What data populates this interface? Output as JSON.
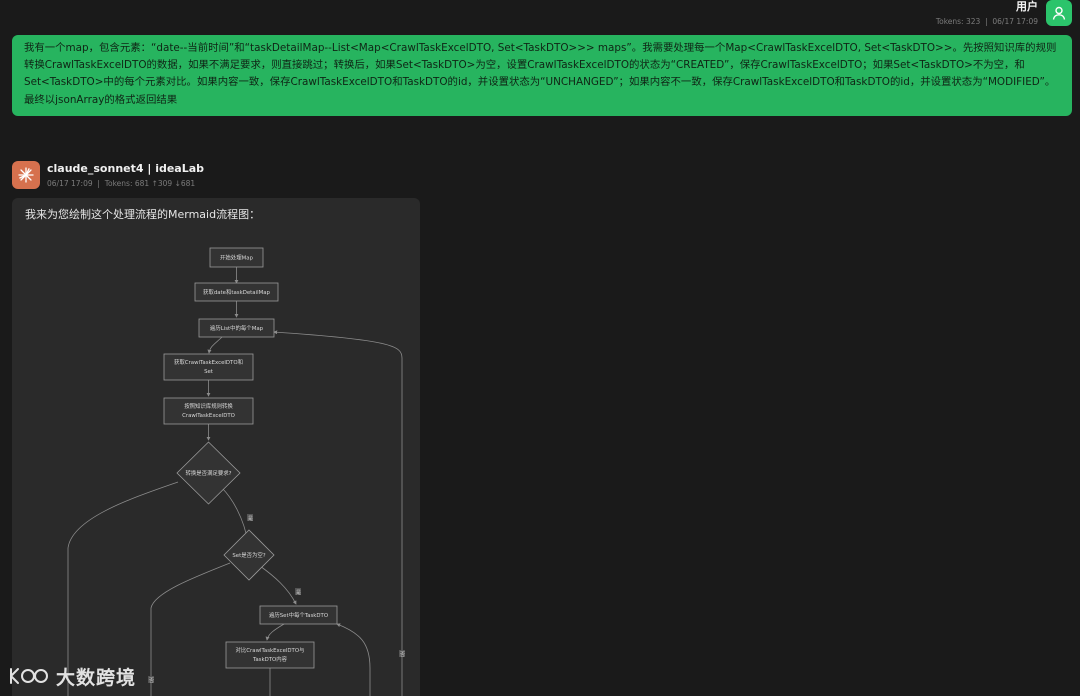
{
  "user": {
    "name": "用户",
    "tokens": "Tokens: 323",
    "time": "06/17 17:09",
    "message": "我有一个map，包含元素：“date--当前时间”和“taskDetailMap--List<Map<CrawlTaskExcelDTO, Set<TaskDTO>>> maps”。我需要处理每一个Map<CrawlTaskExcelDTO, Set<TaskDTO>>。先按照知识库的规则转换CrawlTaskExcelDTO的数据，如果不满足要求，则直接跳过；转换后，如果Set<TaskDTO>为空，设置CrawlTaskExcelDTO的状态为“CREATED”，保存CrawlTaskExcelDTO；如果Set<TaskDTO>不为空，和Set<TaskDTO>中的每个元素对比。如果内容一致，保存CrawlTaskExcelDTO和TaskDTO的id，并设置状态为“UNCHANGED”；如果内容不一致，保存CrawlTaskExcelDTO和TaskDTO的id，并设置状态为“MODIFIED”。最终以jsonArray的格式返回结果"
  },
  "assistant": {
    "name": "claude_sonnet4 | ideaLab",
    "time": "06/17 17:09",
    "tokens": "Tokens: 681",
    "up": "↑309",
    "down": "↓681",
    "intro": "我来为您绘制这个处理流程的Mermaid流程图："
  },
  "flowchart": {
    "nodes": {
      "start": "开始处理Map",
      "get_date": "获取date和taskDetailMap",
      "loop_list": "遍历List中的每个Map",
      "get_dto_1": "获取CrawlTaskExcelDTO和",
      "get_dto_2": "Set",
      "convert_1": "按照知识库规则转换",
      "convert_2": "CrawlTaskExcelDTO",
      "check_req": "转换是否满足要求?",
      "check_empty": "Set是否为空?",
      "loop_set": "遍历Set中每个TaskDTO",
      "compare_1": "对比CrawlTaskExcelDTO与",
      "compare_2": "TaskDTO内容"
    },
    "edge_labels": {
      "yes": "是",
      "no": "否"
    }
  },
  "colors": {
    "background": "#1a1a1a",
    "user_bubble": "#27b45f",
    "user_avatar": "#2bc46b",
    "bot_avatar": "#d6714e",
    "bot_bubble": "#2a2a2a"
  },
  "watermark": {
    "text": "大数跨境"
  }
}
